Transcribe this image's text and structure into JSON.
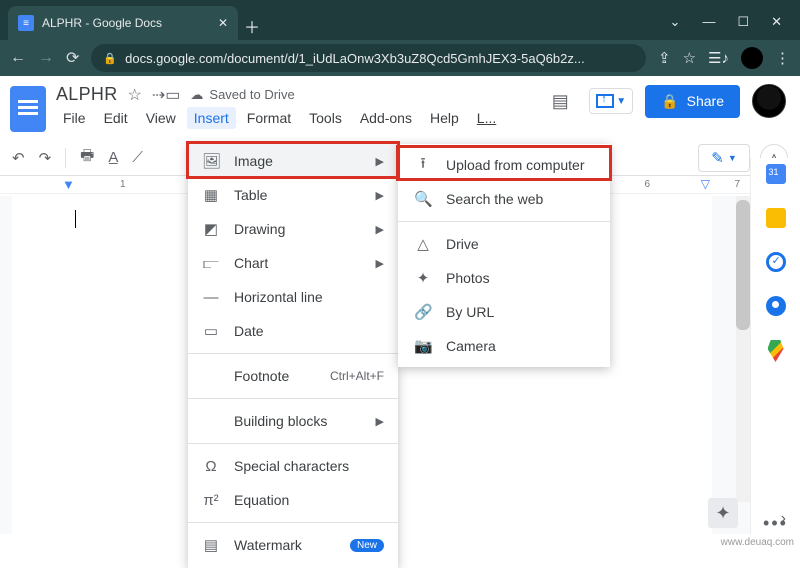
{
  "browser": {
    "tab_title": "ALPHR - Google Docs",
    "url": "docs.google.com/document/d/1_iUdLaOnw3Xb3uZ8Qcd5GmhJEX3-5aQ6b2z..."
  },
  "doc": {
    "title": "ALPHR",
    "saved_label": "Saved to Drive",
    "menus": [
      "File",
      "Edit",
      "View",
      "Insert",
      "Format",
      "Tools",
      "Add-ons",
      "Help",
      "L..."
    ],
    "active_menu_index": 3,
    "share_label": "Share"
  },
  "ruler": {
    "left_ticks": [
      "1"
    ],
    "right_ticks": [
      "6",
      "7"
    ]
  },
  "insert_menu": {
    "items": [
      {
        "icon": "image-icon",
        "label": "Image",
        "submenu": true,
        "hover": true
      },
      {
        "icon": "table-icon",
        "label": "Table",
        "submenu": true
      },
      {
        "icon": "drawing-icon",
        "label": "Drawing",
        "submenu": true
      },
      {
        "icon": "chart-icon",
        "label": "Chart",
        "submenu": true
      },
      {
        "icon": "hr-icon",
        "label": "Horizontal line"
      },
      {
        "icon": "date-icon",
        "label": "Date"
      },
      {
        "icon": "",
        "label": "Footnote",
        "shortcut": "Ctrl+Alt+F",
        "sep_before": true
      },
      {
        "icon": "",
        "label": "Building blocks",
        "submenu": true,
        "sep_before": true
      },
      {
        "icon": "omega-icon",
        "label": "Special characters",
        "sep_before": true
      },
      {
        "icon": "pi-icon",
        "label": "Equation"
      },
      {
        "icon": "watermark-icon",
        "label": "Watermark",
        "badge": "New",
        "sep_before": true
      }
    ]
  },
  "image_submenu": {
    "items": [
      {
        "icon": "upload-icon",
        "label": "Upload from computer"
      },
      {
        "icon": "search-icon",
        "label": "Search the web"
      },
      {
        "icon": "drive-icon",
        "label": "Drive",
        "sep_before": true
      },
      {
        "icon": "photos-icon",
        "label": "Photos"
      },
      {
        "icon": "link-icon",
        "label": "By URL"
      },
      {
        "icon": "camera-icon",
        "label": "Camera"
      }
    ]
  },
  "watermark_text": "www.deuaq.com"
}
